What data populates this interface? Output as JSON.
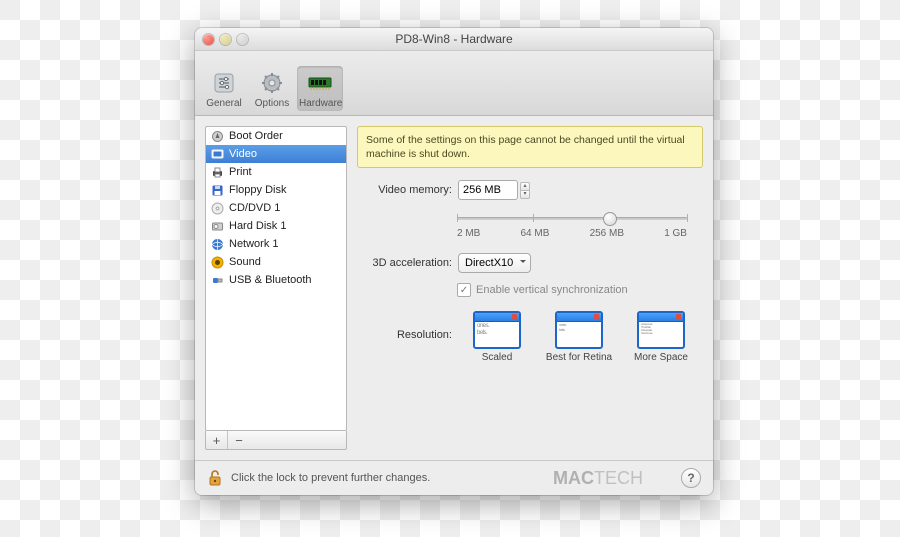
{
  "window": {
    "title": "PD8-Win8 - Hardware"
  },
  "toolbar": {
    "items": [
      {
        "label": "General"
      },
      {
        "label": "Options"
      },
      {
        "label": "Hardware"
      }
    ]
  },
  "sidebar": {
    "items": [
      {
        "label": "Boot Order"
      },
      {
        "label": "Video"
      },
      {
        "label": "Print"
      },
      {
        "label": "Floppy Disk"
      },
      {
        "label": "CD/DVD 1"
      },
      {
        "label": "Hard Disk 1"
      },
      {
        "label": "Network 1"
      },
      {
        "label": "Sound"
      },
      {
        "label": "USB & Bluetooth"
      }
    ],
    "add": "+",
    "remove": "−"
  },
  "main": {
    "warning": "Some of the settings on this page cannot be changed until the virtual machine is shut down.",
    "video_memory_label": "Video memory:",
    "video_memory_value": "256 MB",
    "slider": {
      "ticks": [
        "2 MB",
        "64 MB",
        "256 MB",
        "1 GB"
      ]
    },
    "accel_label": "3D acceleration:",
    "accel_value": "DirectX10",
    "vsync_label": "Enable vertical synchronization",
    "resolution_label": "Resolution:",
    "resolution_opts": [
      {
        "label": "Scaled"
      },
      {
        "label": "Best for Retina"
      },
      {
        "label": "More Space"
      }
    ]
  },
  "footer": {
    "lock_text": "Click the lock to prevent further changes.",
    "brand_a": "MAC",
    "brand_b": "TECH",
    "help": "?"
  }
}
